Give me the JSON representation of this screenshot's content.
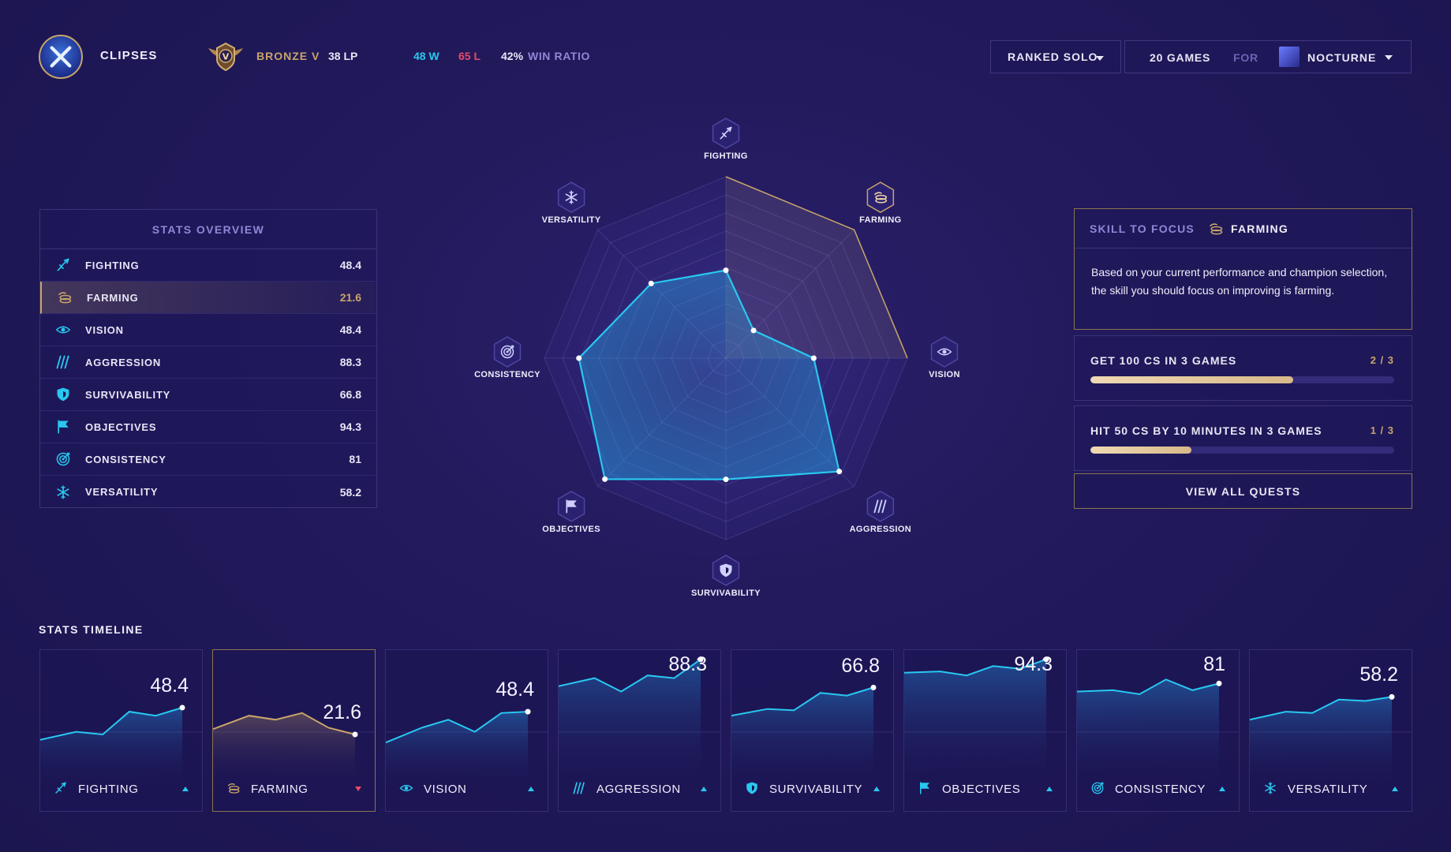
{
  "header": {
    "username": "CLIPSES",
    "rank_tier": "BRONZE V",
    "rank_emblem_letter": "V",
    "rank_lp": "38 LP",
    "wins": "48 W",
    "losses": "65 L",
    "win_pct": "42%",
    "win_ratio_label": "WIN RATIO",
    "queue": "RANKED SOLO",
    "games_count": "20 GAMES",
    "for_label": "FOR",
    "champion": "NOCTURNE"
  },
  "colors": {
    "accent_cyan": "#28c8f0",
    "gold": "#c9a56a",
    "loss_red": "#e84a6a",
    "muted_purple": "#8f88d8"
  },
  "overview": {
    "title": "STATS OVERVIEW",
    "rows": [
      {
        "label": "FIGHTING",
        "value": "48.4",
        "icon": "sword-icon"
      },
      {
        "label": "FARMING",
        "value": "21.6",
        "icon": "coins-icon"
      },
      {
        "label": "VISION",
        "value": "48.4",
        "icon": "eye-icon"
      },
      {
        "label": "AGGRESSION",
        "value": "88.3",
        "icon": "claw-icon"
      },
      {
        "label": "SURVIVABILITY",
        "value": "66.8",
        "icon": "shield-icon"
      },
      {
        "label": "OBJECTIVES",
        "value": "94.3",
        "icon": "flag-icon"
      },
      {
        "label": "CONSISTENCY",
        "value": "81",
        "icon": "target-icon"
      },
      {
        "label": "VERSATILITY",
        "value": "58.2",
        "icon": "snowflake-icon"
      }
    ]
  },
  "radar": {
    "labels": [
      "FIGHTING",
      "FARMING",
      "VISION",
      "AGGRESSION",
      "SURVIVABILITY",
      "OBJECTIVES",
      "CONSISTENCY",
      "VERSATILITY"
    ],
    "values": [
      48.4,
      21.6,
      48.4,
      88.3,
      66.8,
      94.3,
      81,
      58.2
    ],
    "max": 100
  },
  "skill_focus": {
    "label": "SKILL TO FOCUS",
    "skill": "FARMING",
    "icon": "coins-icon",
    "description": "Based on your current performance and champion selection, the skill you should focus on improving is farming."
  },
  "quests": [
    {
      "title": "GET 100 CS IN 3 GAMES",
      "progress": "2 / 3",
      "fraction": 0.667
    },
    {
      "title": "HIT 50 CS BY 10 MINUTES IN 3 GAMES",
      "progress": "1 / 3",
      "fraction": 0.333
    }
  ],
  "view_all_quests": "VIEW ALL QUESTS",
  "timeline": {
    "title": "STATS TIMELINE",
    "cards": [
      {
        "label": "FIGHTING",
        "value": "48.4",
        "trend": "up",
        "icon": "sword-icon",
        "points": [
          36,
          42,
          40,
          57,
          54,
          60
        ]
      },
      {
        "label": "FARMING",
        "value": "21.6",
        "trend": "down",
        "icon": "coins-icon",
        "points": [
          44,
          54,
          51,
          56,
          45,
          40
        ]
      },
      {
        "label": "VISION",
        "value": "48.4",
        "trend": "up",
        "icon": "eye-icon",
        "points": [
          34,
          45,
          51,
          42,
          56,
          57
        ]
      },
      {
        "label": "AGGRESSION",
        "value": "88.3",
        "trend": "up",
        "icon": "claw-icon",
        "points": [
          76,
          82,
          72,
          84,
          82,
          96
        ]
      },
      {
        "label": "SURVIVABILITY",
        "value": "66.8",
        "trend": "up",
        "icon": "shield-icon",
        "points": [
          54,
          59,
          58,
          71,
          69,
          75
        ]
      },
      {
        "label": "OBJECTIVES",
        "value": "94.3",
        "trend": "up",
        "icon": "flag-icon",
        "points": [
          86,
          87,
          84,
          91,
          89,
          96
        ]
      },
      {
        "label": "CONSISTENCY",
        "value": "81",
        "trend": "up",
        "icon": "target-icon",
        "points": [
          72,
          73,
          70,
          81,
          73,
          78
        ]
      },
      {
        "label": "VERSATILITY",
        "value": "58.2",
        "trend": "up",
        "icon": "snowflake-icon",
        "points": [
          51,
          57,
          56,
          66,
          65,
          68
        ]
      }
    ]
  }
}
